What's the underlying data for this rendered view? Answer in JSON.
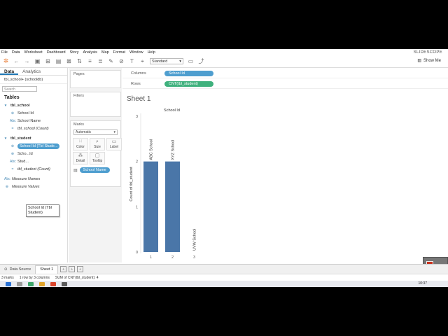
{
  "menu": [
    "File",
    "Data",
    "Worksheet",
    "Dashboard",
    "Story",
    "Analysis",
    "Map",
    "Format",
    "Window",
    "Help"
  ],
  "watermark": "SLIDESCOPE",
  "toolbar": {
    "fit_select": "Standard",
    "show_me": "Show Me"
  },
  "datapane": {
    "tab_data": "Data",
    "tab_analytics": "Analytics",
    "source": "tbl_school+ (schooldb)",
    "search_placeholder": "Search",
    "tables_header": "Tables",
    "t1": {
      "name": "tbl_school",
      "f1": "School Id",
      "f2": "School Name",
      "f3": "tbl_school (Count)"
    },
    "t2": {
      "name": "tbl_student",
      "f1": "School Id (Tbl Stude...",
      "f2": "Scho...Id",
      "f3": "Stud...",
      "f4": "tbl_student (Count)"
    },
    "measure_names": "Measure Names",
    "measure_values": "Measure Values",
    "tooltip": "School Id (Tbl Student)"
  },
  "cards": {
    "pages": "Pages",
    "filters": "Filters",
    "marks": "Marks",
    "marks_type": "Automatic",
    "btns": {
      "color": "Color",
      "size": "Size",
      "label": "Label",
      "detail": "Detail",
      "tooltip": "Tooltip"
    },
    "pill": "School Name"
  },
  "shelves": {
    "columns_label": "Columns",
    "rows_label": "Rows",
    "columns_pill": "School Id",
    "rows_pill": "CNT(tbl_student)"
  },
  "sheet_title": "Sheet 1",
  "chart_data": {
    "type": "bar",
    "title": "School Id",
    "ylabel": "Count of tbl_student",
    "categories": [
      "1",
      "2",
      "3"
    ],
    "bar_labels": [
      "ABC School",
      "XYZ School",
      "UVW School"
    ],
    "values": [
      2,
      2,
      0
    ],
    "ylim": [
      0,
      3
    ],
    "yticks": [
      "0",
      "1",
      "2",
      "3"
    ],
    "bar_color": "#4a76a8",
    "grid": false
  },
  "tabs": {
    "data_source": "Data Source",
    "sheet1": "Sheet 1"
  },
  "status": {
    "marks": "3 marks",
    "rows": "1 row by 3 columns",
    "sum": "SUM of CNT(tbl_student): 4"
  },
  "clock": "10:37"
}
